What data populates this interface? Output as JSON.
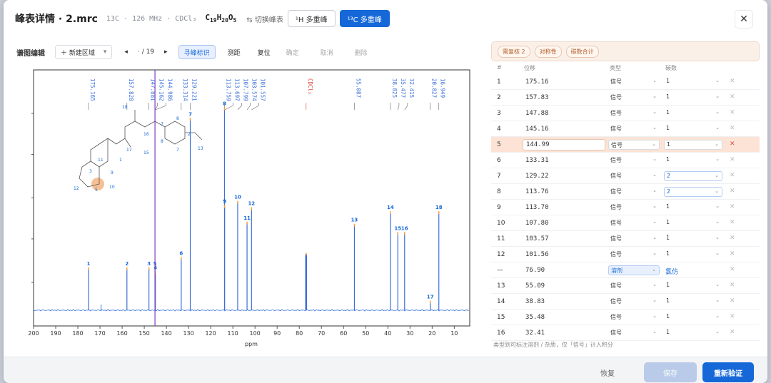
{
  "header": {
    "title": "峰表详情 · 2.mrc",
    "subtitle": "13C · 126 MHz · CDCl₃",
    "formula": {
      "c": "C",
      "cn": "19",
      "h": "H",
      "hn": "20",
      "o": "O",
      "on": "5"
    },
    "switch_label": "⇆ 切换峰表",
    "tab_h": "¹H 多重峰",
    "tab_c": "¹³C 多重峰",
    "close": "✕"
  },
  "toolbar": {
    "label": "谱图编辑",
    "new_region": "＋ 新建区域",
    "region_chevron": "▾",
    "prev": "◂",
    "page_sep": "·",
    "page_total": "/ 19",
    "next": "▸",
    "find_peaks": "寻峰标识",
    "measure": "测距",
    "reset": "复位",
    "confirm": "确定",
    "cancel": "取消",
    "delete": "删除"
  },
  "chart_data": {
    "type": "line",
    "title": "",
    "xlabel": "ppm",
    "ylabel": "",
    "xlim": [
      200,
      3
    ],
    "x_ticks": [
      200,
      190,
      180,
      170,
      160,
      150,
      140,
      130,
      120,
      110,
      100,
      90,
      80,
      70,
      60,
      50,
      40,
      30,
      20,
      10
    ],
    "cursor_ppm": 145.16,
    "peaks": [
      {
        "ppm": 175.165,
        "height": 0.2,
        "label": "175.165",
        "id": "1"
      },
      {
        "ppm": 157.828,
        "height": 0.2,
        "label": "157.828",
        "id": "2"
      },
      {
        "ppm": 147.881,
        "height": 0.2,
        "label": "147.881",
        "id": "3"
      },
      {
        "ppm": 145.162,
        "height": 0.2,
        "label": "145.162",
        "id": "5"
      },
      {
        "ppm": 144.986,
        "height": 0.18,
        "label": "144.986",
        "id": "4"
      },
      {
        "ppm": 133.314,
        "height": 0.25,
        "label": "133.314",
        "id": "6"
      },
      {
        "ppm": 129.221,
        "height": 0.92,
        "label": "129.221",
        "id": "7"
      },
      {
        "ppm": 113.759,
        "height": 0.97,
        "label": "113.759",
        "id": "8"
      },
      {
        "ppm": 113.697,
        "height": 0.5,
        "label": "113.697",
        "id": "9"
      },
      {
        "ppm": 107.799,
        "height": 0.52,
        "label": "107.799",
        "id": "10"
      },
      {
        "ppm": 103.574,
        "height": 0.42,
        "label": "103.574",
        "id": "11"
      },
      {
        "ppm": 101.557,
        "height": 0.49,
        "label": "101.557",
        "id": "12"
      },
      {
        "ppm": 76.9,
        "height": 0.27,
        "label": "CDCl₃",
        "id": ""
      },
      {
        "ppm": 55.087,
        "height": 0.41,
        "label": "55.087",
        "id": "13"
      },
      {
        "ppm": 38.825,
        "height": 0.47,
        "label": "38.825",
        "id": "14"
      },
      {
        "ppm": 35.477,
        "height": 0.37,
        "label": "35.477",
        "id": "15"
      },
      {
        "ppm": 32.415,
        "height": 0.37,
        "label": "32.415",
        "id": "16"
      },
      {
        "ppm": 20.827,
        "height": 0.04,
        "label": "20.827",
        "id": "17"
      },
      {
        "ppm": 16.949,
        "height": 0.47,
        "label": "16.949",
        "id": "18"
      }
    ],
    "atom_labels": [
      "18",
      "16",
      "17",
      "15",
      "7",
      "8",
      "2",
      "7",
      "8",
      "13",
      "11",
      "1",
      "3",
      "9",
      "12",
      "5",
      "10"
    ]
  },
  "table": {
    "tags": [
      "需复核 2",
      "对称性",
      "碳数合计"
    ],
    "headers": {
      "idx": "#",
      "shift": "位移",
      "type": "类型",
      "count": "碳数"
    },
    "chevron": "⌄",
    "del": "✕",
    "rows": [
      {
        "idx": "1",
        "shift": "175.16",
        "type": "信号",
        "count": "1"
      },
      {
        "idx": "2",
        "shift": "157.83",
        "type": "信号",
        "count": "1"
      },
      {
        "idx": "3",
        "shift": "147.88",
        "type": "信号",
        "count": "1"
      },
      {
        "idx": "4",
        "shift": "145.16",
        "type": "信号",
        "count": "1"
      },
      {
        "idx": "5",
        "shift": "144.99",
        "type": "信号",
        "count": "1"
      },
      {
        "idx": "6",
        "shift": "133.31",
        "type": "信号",
        "count": "1"
      },
      {
        "idx": "7",
        "shift": "129.22",
        "type": "信号",
        "count": "2"
      },
      {
        "idx": "8",
        "shift": "113.76",
        "type": "信号",
        "count": "2"
      },
      {
        "idx": "9",
        "shift": "113.70",
        "type": "信号",
        "count": "1"
      },
      {
        "idx": "10",
        "shift": "107.80",
        "type": "信号",
        "count": "1"
      },
      {
        "idx": "11",
        "shift": "103.57",
        "type": "信号",
        "count": "1"
      },
      {
        "idx": "12",
        "shift": "101.56",
        "type": "信号",
        "count": "1"
      },
      {
        "idx": "—",
        "shift": "76.90",
        "type": "溶剂",
        "count": "氯仿"
      },
      {
        "idx": "13",
        "shift": "55.09",
        "type": "信号",
        "count": "1"
      },
      {
        "idx": "14",
        "shift": "38.83",
        "type": "信号",
        "count": "1"
      },
      {
        "idx": "15",
        "shift": "35.48",
        "type": "信号",
        "count": "1"
      },
      {
        "idx": "16",
        "shift": "32.41",
        "type": "信号",
        "count": "1"
      }
    ],
    "note": "类型到可标注溶剂 / 杂质，仅「信号」计入积分"
  },
  "footer": {
    "restore": "恢复",
    "save": "保存",
    "reverify": "重新验证"
  },
  "colors": {
    "accent": "#1668d8",
    "spectrum": "#3a6fd8",
    "cursor": "#7b3fc0",
    "solvent": "#d9433a",
    "highlight_row": "#fde3d6"
  }
}
